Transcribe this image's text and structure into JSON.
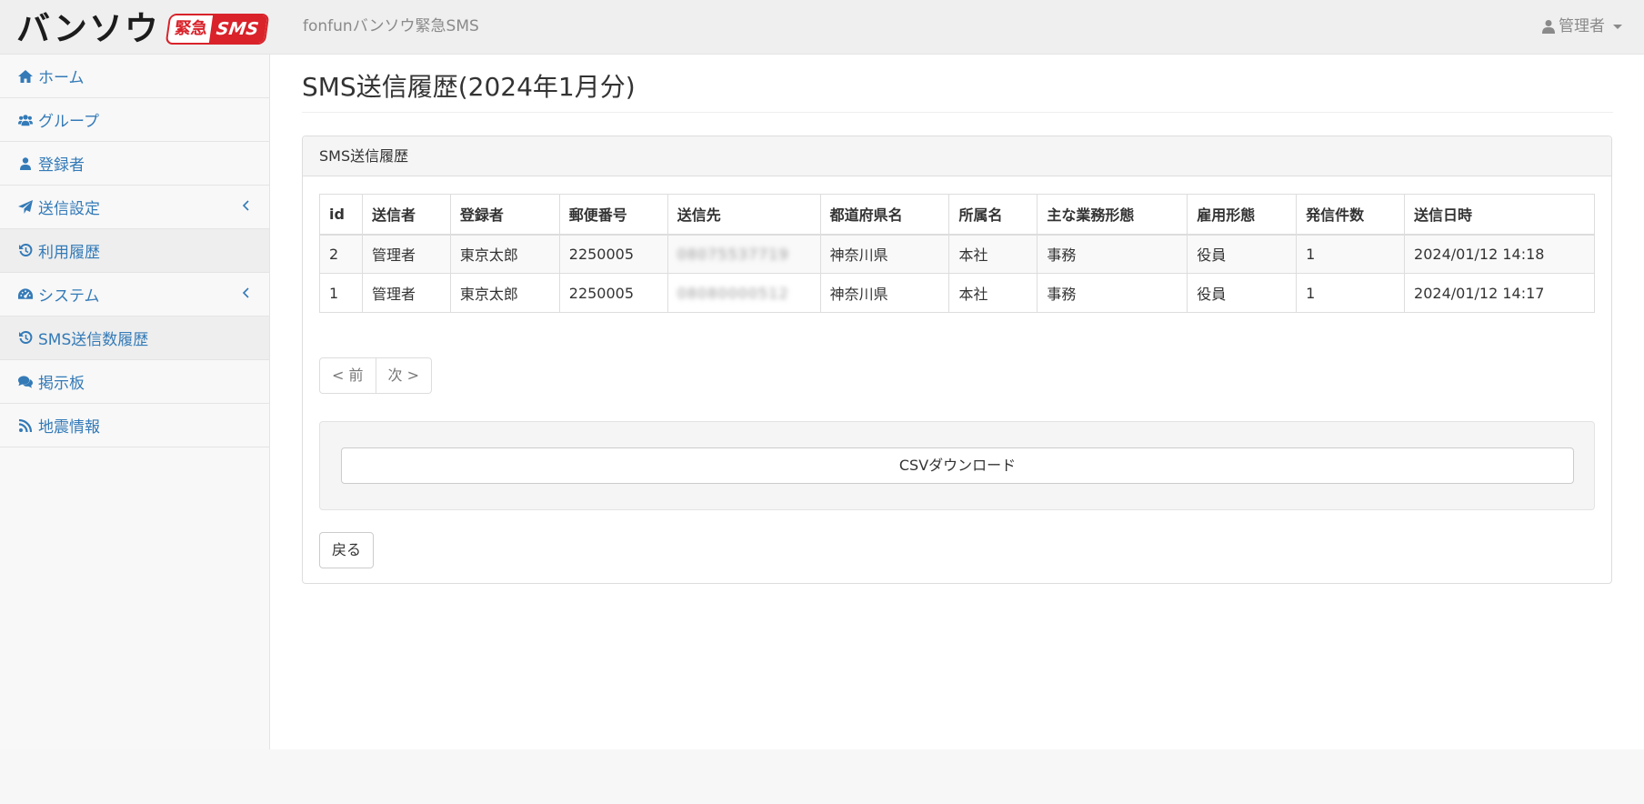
{
  "header": {
    "logo_text": "バンソウ",
    "logo_badge_kanji": "緊急",
    "logo_badge_sms": "SMS",
    "app_title": "fonfunバンソウ緊急SMS",
    "user_label": "管理者"
  },
  "sidebar": {
    "items": [
      {
        "label": "ホーム",
        "icon": "home-icon"
      },
      {
        "label": "グループ",
        "icon": "users-icon"
      },
      {
        "label": "登録者",
        "icon": "user-icon"
      },
      {
        "label": "送信設定",
        "icon": "paper-plane-icon"
      },
      {
        "label": "利用履歴",
        "icon": "history-icon"
      },
      {
        "label": "システム",
        "icon": "dashboard-icon"
      },
      {
        "label": "SMS送信数履歴",
        "icon": "history-icon"
      },
      {
        "label": "掲示板",
        "icon": "comments-icon"
      },
      {
        "label": "地震情報",
        "icon": "rss-icon"
      }
    ]
  },
  "main": {
    "page_title": "SMS送信履歴(2024年1月分)",
    "panel_title": "SMS送信履歴",
    "table": {
      "headers": [
        "id",
        "送信者",
        "登録者",
        "郵便番号",
        "送信先",
        "都道府県名",
        "所属名",
        "主な業務形態",
        "雇用形態",
        "発信件数",
        "送信日時"
      ],
      "rows": [
        [
          "2",
          "管理者",
          "東京太郎",
          "2250005",
          "08075537719",
          "神奈川県",
          "本社",
          "事務",
          "役員",
          "1",
          "2024/01/12 14:18"
        ],
        [
          "1",
          "管理者",
          "東京太郎",
          "2250005",
          "08080000512",
          "神奈川県",
          "本社",
          "事務",
          "役員",
          "1",
          "2024/01/12 14:17"
        ]
      ]
    },
    "pager": {
      "prev": "< 前",
      "next": "次 >"
    },
    "csv_button": "CSVダウンロード",
    "back_button": "戻る"
  },
  "colors": {
    "link": "#337ab7",
    "brand_red": "#d9222a"
  }
}
